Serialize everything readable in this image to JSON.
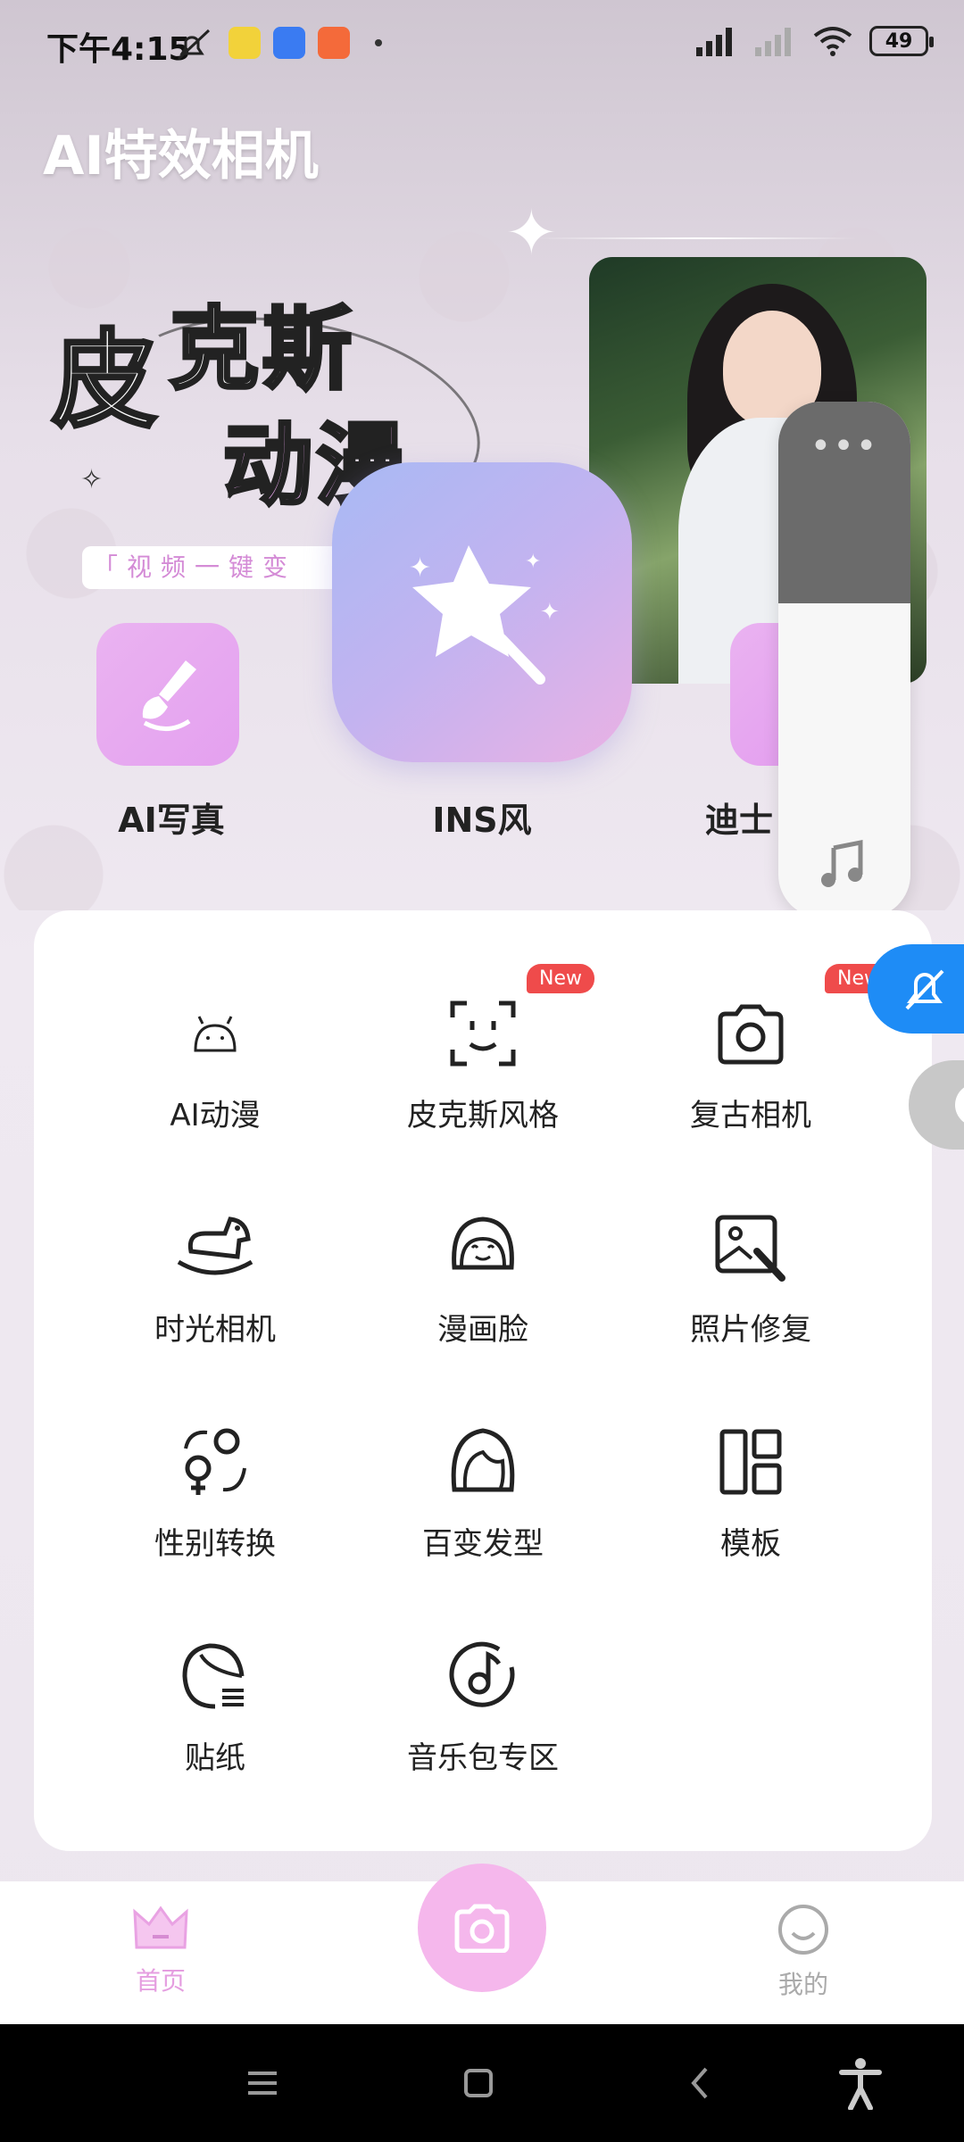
{
  "status_bar": {
    "time": "下午4:15",
    "battery": "49"
  },
  "app": {
    "title": "AI特效相机"
  },
  "banner": {
    "line1": "皮",
    "line2": "克斯",
    "line3": "动漫",
    "caption": "「视频一键变"
  },
  "quick_features": [
    {
      "label": "AI写真"
    },
    {
      "label": "INS风"
    },
    {
      "label": "迪士"
    }
  ],
  "features": [
    {
      "label": "AI动漫",
      "icon": "android-head-icon",
      "badge": ""
    },
    {
      "label": "皮克斯风格",
      "icon": "face-scan-icon",
      "badge": "New"
    },
    {
      "label": "复古相机",
      "icon": "camera-icon",
      "badge": "New"
    },
    {
      "label": "时光相机",
      "icon": "rocking-horse-icon",
      "badge": ""
    },
    {
      "label": "漫画脸",
      "icon": "cartoon-face-icon",
      "badge": ""
    },
    {
      "label": "照片修复",
      "icon": "photo-repair-icon",
      "badge": ""
    },
    {
      "label": "性别转换",
      "icon": "gender-swap-icon",
      "badge": ""
    },
    {
      "label": "百变发型",
      "icon": "hairstyle-icon",
      "badge": ""
    },
    {
      "label": "模板",
      "icon": "template-icon",
      "badge": ""
    },
    {
      "label": "贴纸",
      "icon": "sticker-icon",
      "badge": ""
    },
    {
      "label": "音乐包专区",
      "icon": "music-disc-icon",
      "badge": ""
    }
  ],
  "tabs": {
    "home": "首页",
    "mine": "我的"
  },
  "colors": {
    "accent_pink": "#f5b7ec",
    "badge_red": "#ef4b4b",
    "mute_blue": "#1e8cf6"
  }
}
